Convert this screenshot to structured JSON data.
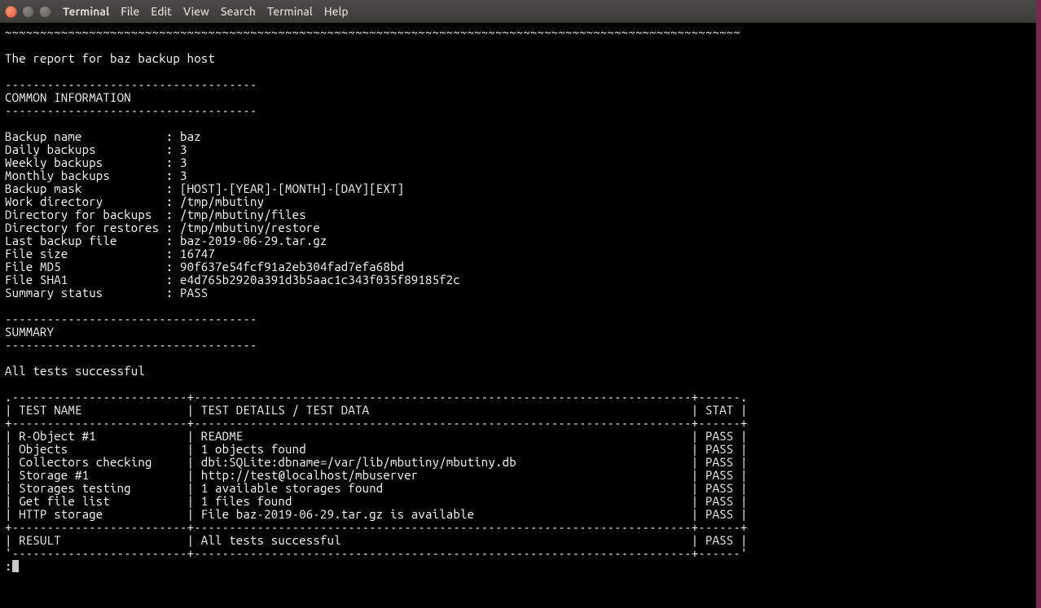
{
  "window": {
    "app_label": "Terminal",
    "menu": [
      "File",
      "Edit",
      "View",
      "Search",
      "Terminal",
      "Help"
    ]
  },
  "terminal": {
    "tilde_ruler": "~~~~~~~~~~~~~~~~~~~~~~~~~~~~~~~~~~~~~~~~~~~~~~~~~~~~~~~~~~~~~~~~~~~~~~~~~~~~~~~~~~~~~~~~~~~~~~~~~~~~~~~~~",
    "report_title": "The report for baz backup host",
    "dash_short": "------------------------------------",
    "section_common_header": "COMMON INFORMATION",
    "common_info": [
      {
        "label": "Backup name",
        "value": "baz"
      },
      {
        "label": "Daily backups",
        "value": "3"
      },
      {
        "label": "Weekly backups",
        "value": "3"
      },
      {
        "label": "Monthly backups",
        "value": "3"
      },
      {
        "label": "Backup mask",
        "value": "[HOST]-[YEAR]-[MONTH]-[DAY][EXT]"
      },
      {
        "label": "Work directory",
        "value": "/tmp/mbutiny"
      },
      {
        "label": "Directory for backups",
        "value": "/tmp/mbutiny/files"
      },
      {
        "label": "Directory for restores",
        "value": "/tmp/mbutiny/restore"
      },
      {
        "label": "Last backup file",
        "value": "baz-2019-06-29.tar.gz"
      },
      {
        "label": "File size",
        "value": "16747"
      },
      {
        "label": "File MD5",
        "value": "90f637e54fcf91a2eb304fad7efa68bd"
      },
      {
        "label": "File SHA1",
        "value": "e4d765b2920a391d3b5aac1c343f035f89185f2c"
      },
      {
        "label": "Summary status",
        "value": "PASS"
      }
    ],
    "section_summary_header": "SUMMARY",
    "summary_line": "All tests successful",
    "table": {
      "hruler": ".-------------------------+-----------------------------------------------------------------------+------.",
      "mruler": "+-------------------------+-----------------------------------------------------------------------+------+",
      "fruler": "'-------------------------+-----------------------------------------------------------------------+------'",
      "header": {
        "name": "TEST NAME",
        "details": "TEST DETAILS / TEST DATA",
        "stat": "STAT"
      },
      "rows": [
        {
          "name": "R-Object #1",
          "details": "README",
          "stat": "PASS"
        },
        {
          "name": "Objects",
          "details": "1 objects found",
          "stat": "PASS"
        },
        {
          "name": "Collectors checking",
          "details": "dbi:SQLite:dbname=/var/lib/mbutiny/mbutiny.db",
          "stat": "PASS"
        },
        {
          "name": "Storage #1",
          "details": "http://test@localhost/mbuserver",
          "stat": "PASS"
        },
        {
          "name": "Storages testing",
          "details": "1 available storages found",
          "stat": "PASS"
        },
        {
          "name": "Get file list",
          "details": "1 files found",
          "stat": "PASS"
        },
        {
          "name": "HTTP storage",
          "details": "File baz-2019-06-29.tar.gz is available",
          "stat": "PASS"
        }
      ],
      "footer": {
        "name": "RESULT",
        "details": "All tests successful",
        "stat": "PASS"
      }
    },
    "prompt": ":"
  }
}
